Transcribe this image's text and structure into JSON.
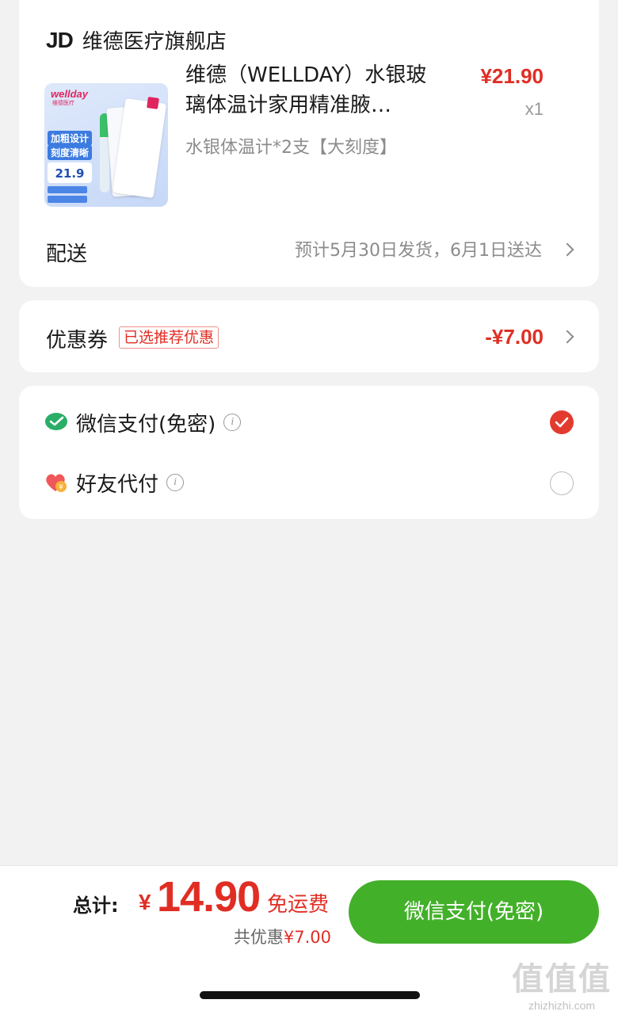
{
  "store": {
    "logo_text": "JD",
    "name": "维德医疗旗舰店"
  },
  "product": {
    "image": {
      "brand": "wellday",
      "brand_sub": "维德医疗",
      "slogan_line1": "加粗设计",
      "slogan_line2": "刻度清晰",
      "price_shown": "21.9"
    },
    "title": "维德（WELLDAY）水银玻璃体温计家用精准腋…",
    "price": "¥21.90",
    "quantity": "x1",
    "spec": "水银体温计*2支【大刻度】"
  },
  "shipping": {
    "label": "配送",
    "info": "预计5月30日发货，6月1日送达"
  },
  "coupon": {
    "label": "优惠券",
    "badge": "已选推荐优惠",
    "value": "-¥7.00"
  },
  "payment_methods": [
    {
      "label": "微信支付(免密)",
      "icon": "wechat-icon",
      "selected": true
    },
    {
      "label": "好友代付",
      "icon": "friend-pay-icon",
      "selected": false
    }
  ],
  "footer": {
    "total_label": "总计:",
    "currency": "¥",
    "total_amount": "14.90",
    "free_shipping": "免运费",
    "saved_prefix": "共优惠",
    "saved_amount": "¥7.00",
    "pay_button": "微信支付(免密)"
  },
  "watermark": {
    "glyphs": "值值值",
    "site": "zhizhizhi.com"
  },
  "colors": {
    "accent_red": "#e02e24",
    "pay_green": "#43b02a",
    "background": "#f2f2f2"
  }
}
